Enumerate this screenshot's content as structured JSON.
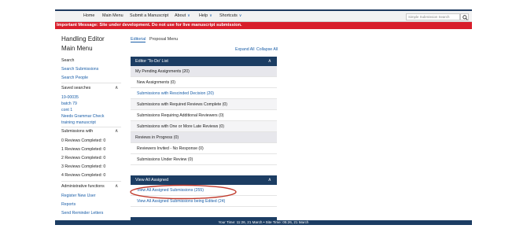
{
  "topnav": {
    "items": [
      {
        "label": "Home"
      },
      {
        "label": "Main Menu"
      },
      {
        "label": "Submit a Manuscript"
      },
      {
        "label": "About",
        "chevron": "∨"
      },
      {
        "label": "Help",
        "chevron": "∨"
      },
      {
        "label": "Shortcuts",
        "chevron": "∨"
      }
    ],
    "search_placeholder": "Simple Submission Search",
    "search_icon": "search-icon"
  },
  "alert": {
    "message": "Important Message: Site under development. Do not use for live manuscript submission.",
    "color": "#d81e2b"
  },
  "sidebar": {
    "title": "Handling Editor",
    "subtitle": "Main Menu",
    "search_heading": "Search",
    "search_links": [
      "Search Submissions",
      "Search People"
    ],
    "saved_heading": "Saved searches",
    "saved_links": [
      "19-00035",
      "batch 79",
      "cont 1",
      "Needs Grammar Check",
      "training manuscript"
    ],
    "subs_heading": "Submissions with",
    "subs_items": [
      "0 Reviews Completed: 0",
      "1 Reviews Completed: 0",
      "2 Reviews Completed: 0",
      "3 Reviews Completed: 0",
      "4 Reviews Completed: 0"
    ],
    "admin_heading": "Administrative functions",
    "admin_links": [
      "Register New User",
      "Reports",
      "Send Reminder Letters"
    ],
    "chevron": "∧"
  },
  "tabs": [
    {
      "label": "Editorial",
      "active": true
    },
    {
      "label": "Proposal Menu",
      "active": false
    }
  ],
  "expand_all": "Expand All",
  "collapse_all": "Collapse All",
  "todo": {
    "heading": "Editor 'To-Do' List",
    "chevron": "∧",
    "rows": [
      {
        "label": "My Pending Assignments (20)",
        "kind": "group"
      },
      {
        "label": "New Assignments (0)",
        "kind": "plain"
      },
      {
        "label": "Submissions with Rescinded Decision (20)",
        "kind": "link"
      },
      {
        "label": "Submissions with Required Reviews Complete (0)",
        "kind": "plain"
      },
      {
        "label": "Submissions Requiring Additional Reviewers (0)",
        "kind": "alt"
      },
      {
        "label": "Submissions with One or More Late Reviews (0)",
        "kind": "plain"
      },
      {
        "label": "Reviews in Progress (0)",
        "kind": "group"
      },
      {
        "label": "Reviewers Invited - No Response (0)",
        "kind": "plain"
      },
      {
        "label": "Submissions Under Review (0)",
        "kind": "plain"
      }
    ]
  },
  "assigned": {
    "heading": "View All Assigned",
    "chevron": "∧",
    "rows": [
      {
        "label": "View All Assigned Submissions (255)",
        "kind": "link"
      },
      {
        "label": "View All Assigned Submissions being Edited (24)",
        "kind": "link"
      }
    ]
  },
  "footer": {
    "text": "Your Time: 11:26, 21 March • Site Time: 05:26, 21 March"
  },
  "colors": {
    "nav_dark": "#1c3d63",
    "link": "#1a5ea8",
    "annotation": "#c0392b"
  }
}
